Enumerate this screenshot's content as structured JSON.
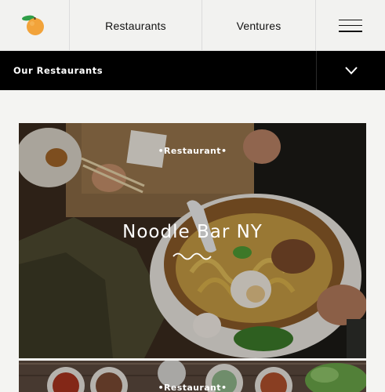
{
  "nav": {
    "logo_icon": "orange-fruit-icon",
    "items": [
      {
        "label": "Restaurants"
      },
      {
        "label": "Ventures"
      }
    ],
    "menu_icon": "hamburger-menu-icon"
  },
  "subbar": {
    "title": "Our Restaurants",
    "toggle_icon": "chevron-down-icon"
  },
  "cards": [
    {
      "kicker": "•Restaurant•",
      "title": "Noodle Bar NY"
    },
    {
      "kicker": "•Restaurant•"
    }
  ],
  "colors": {
    "accent_orange": "#f2a33a",
    "leaf_green": "#2f9e48",
    "subbar_bg": "#000000"
  }
}
